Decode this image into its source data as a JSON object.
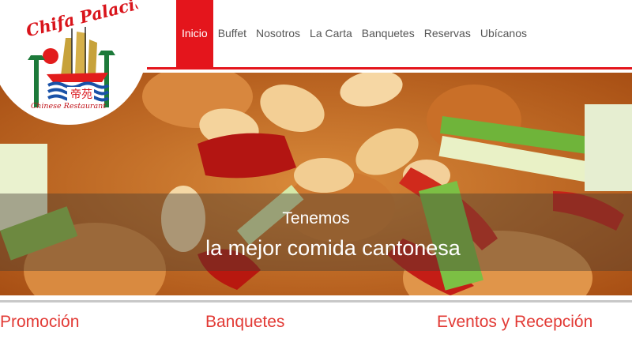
{
  "logo": {
    "title": "Chifa Palacio",
    "chinese": "帝苑",
    "subtitle": "Chinese Restaurant"
  },
  "nav": {
    "items": [
      {
        "label": "Inicio",
        "active": true
      },
      {
        "label": "Buffet"
      },
      {
        "label": "Nosotros"
      },
      {
        "label": "La Carta"
      },
      {
        "label": "Banquetes"
      },
      {
        "label": "Reservas"
      },
      {
        "label": "Ubícanos"
      }
    ]
  },
  "hero": {
    "line1": "Tenemos",
    "line2": "la mejor comida cantonesa"
  },
  "sections": {
    "promocion": "Promoción",
    "banquetes": "Banquetes",
    "eventos": "Eventos y Recepción"
  },
  "colors": {
    "brand_red": "#e4151c",
    "section_red": "#e23a35"
  }
}
